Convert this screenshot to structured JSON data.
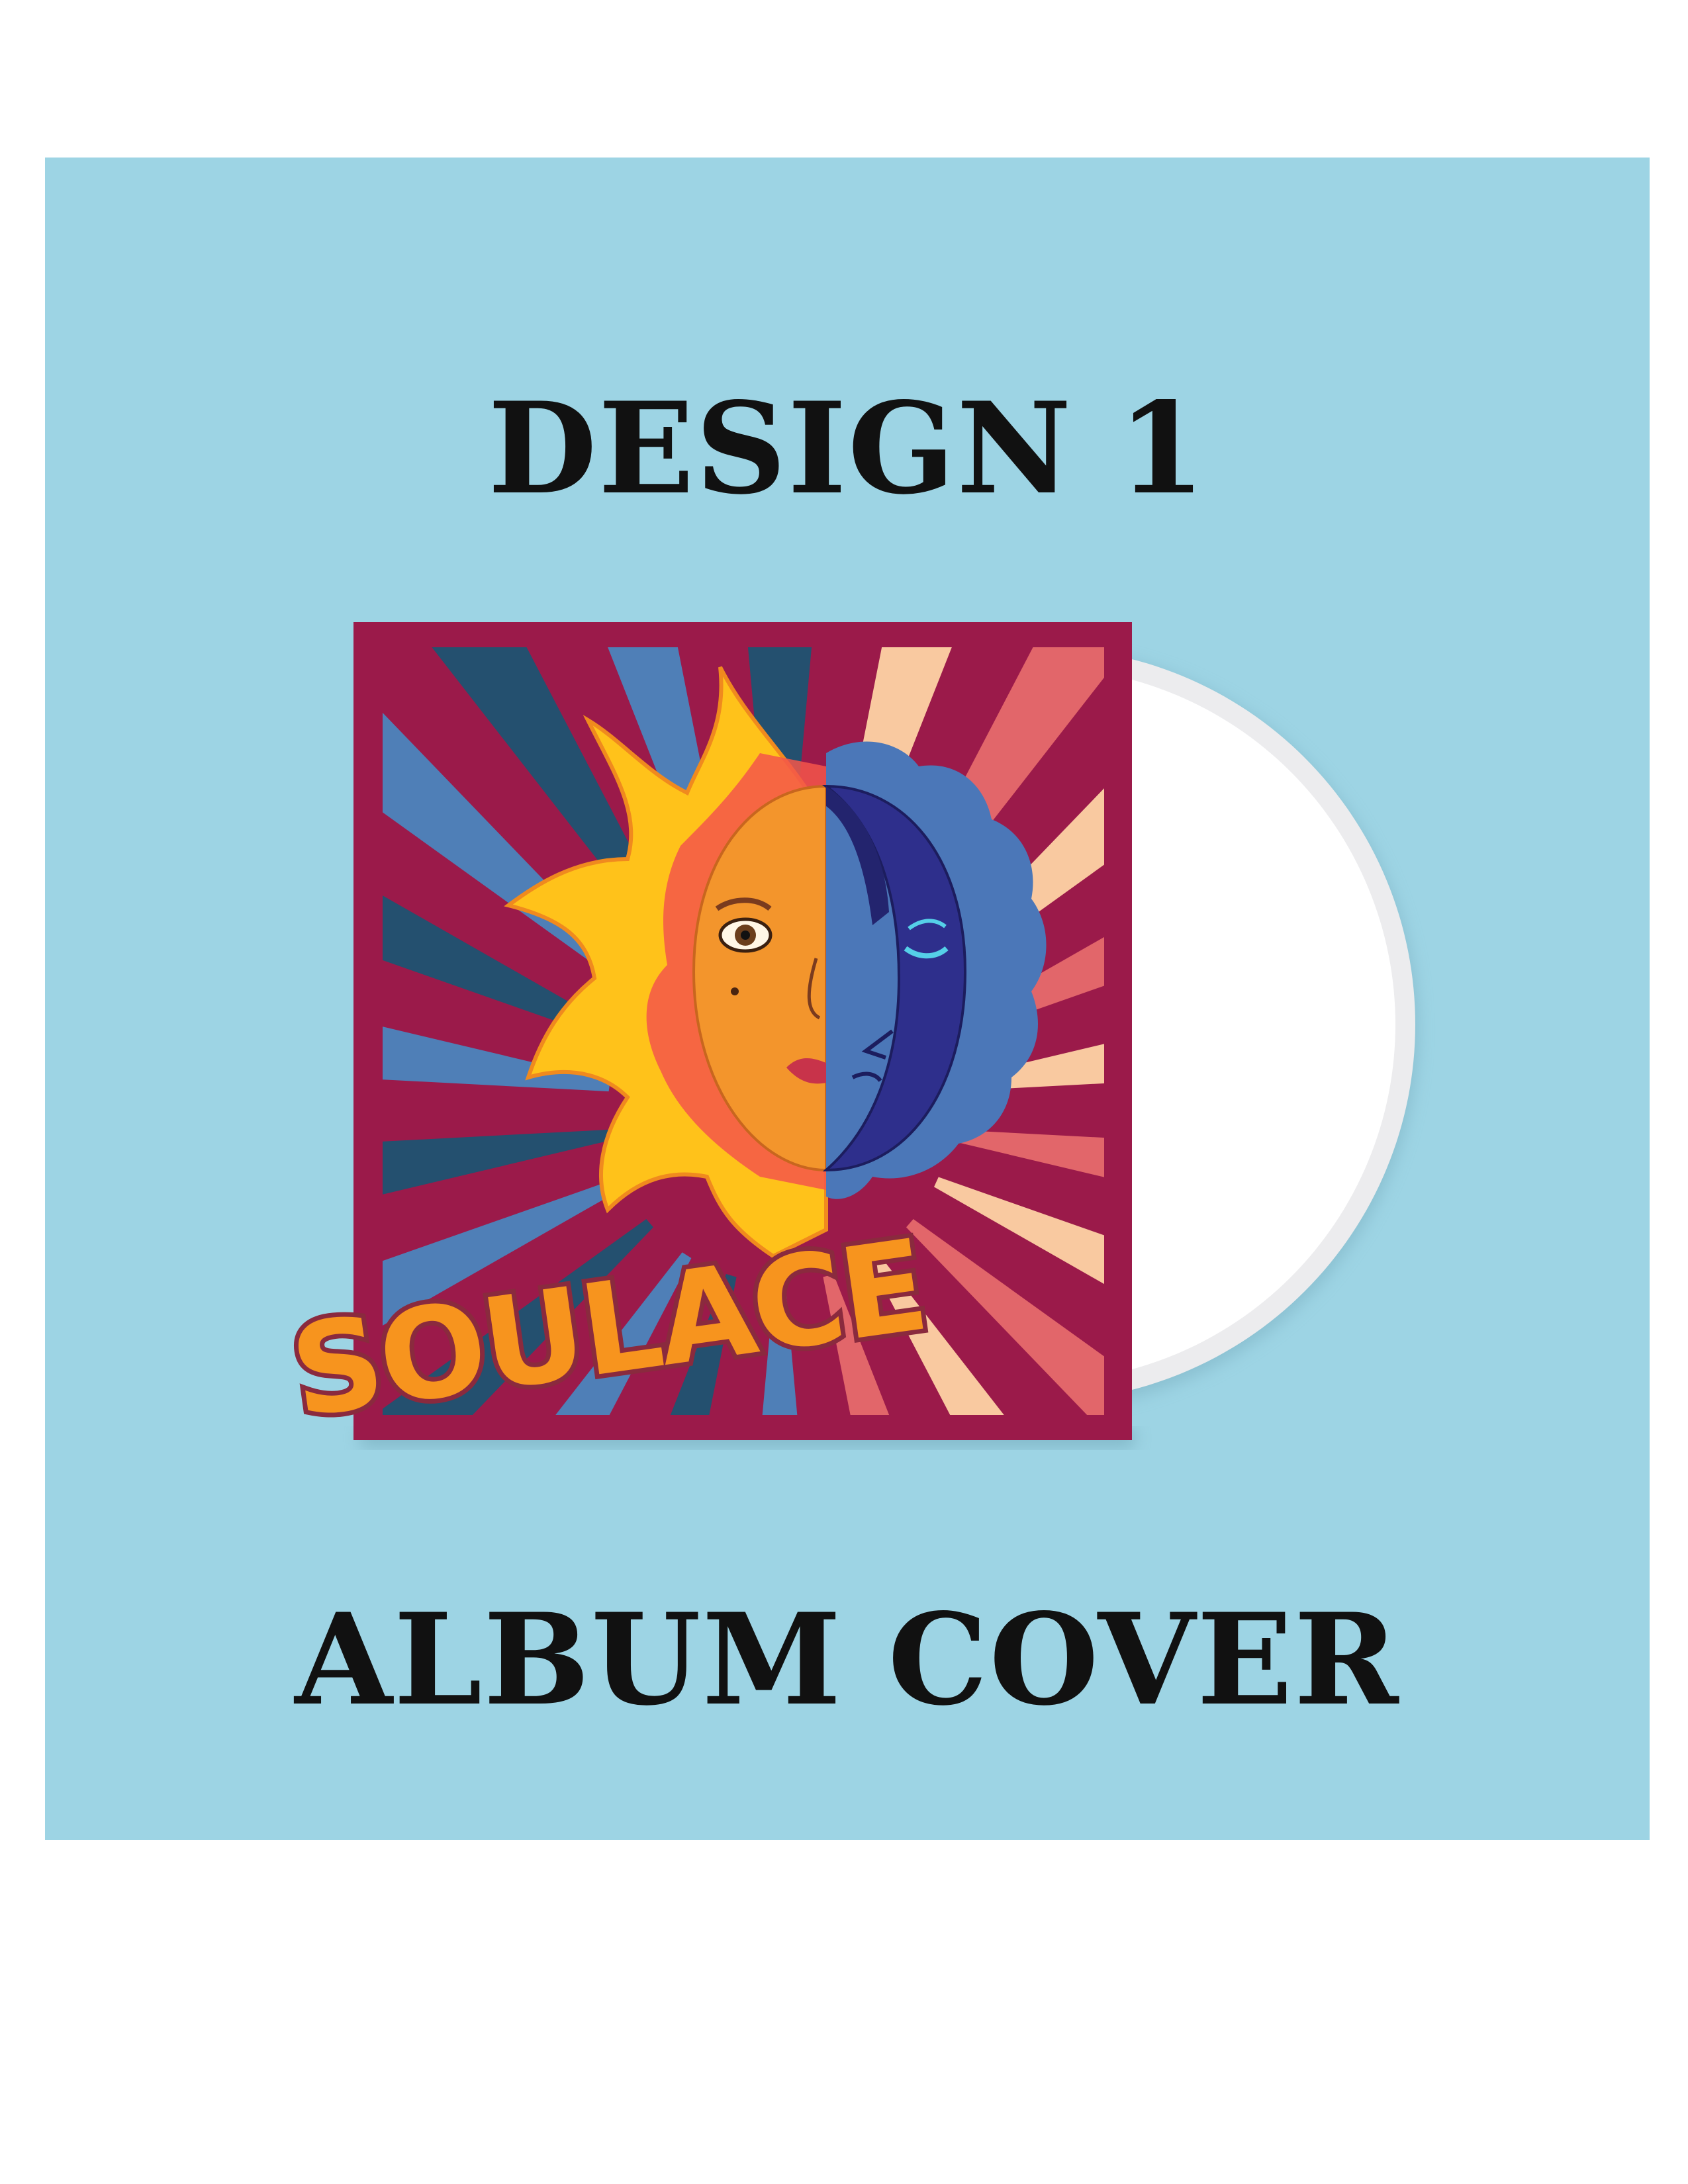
{
  "headings": {
    "top": "DESIGN 1",
    "bottom": "ALBUM COVER"
  },
  "cover": {
    "title_art": "SOULACE",
    "motif": [
      "sun-face-icon",
      "crescent-moon-icon",
      "sunburst-rays"
    ]
  },
  "colors": {
    "panel": "#9dd4e4",
    "cover_bg": "#9b1a4a",
    "ray_navy": "#24506f",
    "ray_blue": "#4f7fb7",
    "ray_coral": "#e2666a",
    "ray_peach": "#f9c9a0",
    "sun_yellow": "#ffc21a",
    "sun_orange": "#f3952c",
    "moon_indigo": "#2e2f8c",
    "cloud_blue": "#4b77b8",
    "disc_white": "#ffffff"
  }
}
